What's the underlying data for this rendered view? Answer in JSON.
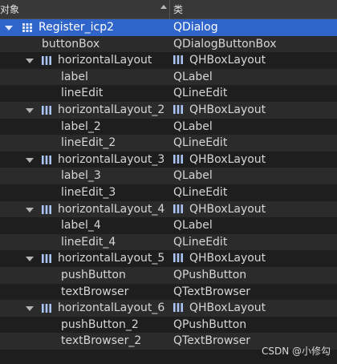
{
  "header": {
    "object_col": "对象",
    "class_col": "类"
  },
  "rows": [
    {
      "name": "Register_icp2",
      "cls": "QDialog",
      "level": 0,
      "expanded": true,
      "selected": true,
      "icon": "grid-icon",
      "cls_icon": ""
    },
    {
      "name": "buttonBox",
      "cls": "QDialogButtonBox",
      "level": 1,
      "expanded": false,
      "icon": "",
      "cls_icon": ""
    },
    {
      "name": "horizontalLayout",
      "cls": "QHBoxLayout",
      "level": 1,
      "expanded": true,
      "icon": "hbox-layout-icon",
      "cls_icon": "hbox-layout-icon"
    },
    {
      "name": "label",
      "cls": "QLabel",
      "level": 2,
      "icon": "",
      "cls_icon": ""
    },
    {
      "name": "lineEdit",
      "cls": "QLineEdit",
      "level": 2,
      "icon": "",
      "cls_icon": ""
    },
    {
      "name": "horizontalLayout_2",
      "cls": "QHBoxLayout",
      "level": 1,
      "expanded": true,
      "icon": "hbox-layout-icon",
      "cls_icon": "hbox-layout-icon"
    },
    {
      "name": "label_2",
      "cls": "QLabel",
      "level": 2,
      "icon": "",
      "cls_icon": ""
    },
    {
      "name": "lineEdit_2",
      "cls": "QLineEdit",
      "level": 2,
      "icon": "",
      "cls_icon": ""
    },
    {
      "name": "horizontalLayout_3",
      "cls": "QHBoxLayout",
      "level": 1,
      "expanded": true,
      "icon": "hbox-layout-icon",
      "cls_icon": "hbox-layout-icon"
    },
    {
      "name": "label_3",
      "cls": "QLabel",
      "level": 2,
      "icon": "",
      "cls_icon": ""
    },
    {
      "name": "lineEdit_3",
      "cls": "QLineEdit",
      "level": 2,
      "icon": "",
      "cls_icon": ""
    },
    {
      "name": "horizontalLayout_4",
      "cls": "QHBoxLayout",
      "level": 1,
      "expanded": true,
      "icon": "hbox-layout-icon",
      "cls_icon": "hbox-layout-icon"
    },
    {
      "name": "label_4",
      "cls": "QLabel",
      "level": 2,
      "icon": "",
      "cls_icon": ""
    },
    {
      "name": "lineEdit_4",
      "cls": "QLineEdit",
      "level": 2,
      "icon": "",
      "cls_icon": ""
    },
    {
      "name": "horizontalLayout_5",
      "cls": "QHBoxLayout",
      "level": 1,
      "expanded": true,
      "icon": "hbox-layout-icon",
      "cls_icon": "hbox-layout-icon"
    },
    {
      "name": "pushButton",
      "cls": "QPushButton",
      "level": 2,
      "icon": "",
      "cls_icon": ""
    },
    {
      "name": "textBrowser",
      "cls": "QTextBrowser",
      "level": 2,
      "icon": "",
      "cls_icon": ""
    },
    {
      "name": "horizontalLayout_6",
      "cls": "QHBoxLayout",
      "level": 1,
      "expanded": true,
      "icon": "hbox-layout-icon",
      "cls_icon": "hbox-layout-icon"
    },
    {
      "name": "pushButton_2",
      "cls": "QPushButton",
      "level": 2,
      "icon": "",
      "cls_icon": ""
    },
    {
      "name": "textBrowser_2",
      "cls": "QTextBrowser",
      "level": 2,
      "icon": "",
      "cls_icon": ""
    }
  ],
  "watermark": "CSDN @小修勾",
  "colors": {
    "selection": "#2f65ca",
    "background": "#1e1e1e",
    "alt_row": "#2b2b2b",
    "header": "#383838"
  }
}
